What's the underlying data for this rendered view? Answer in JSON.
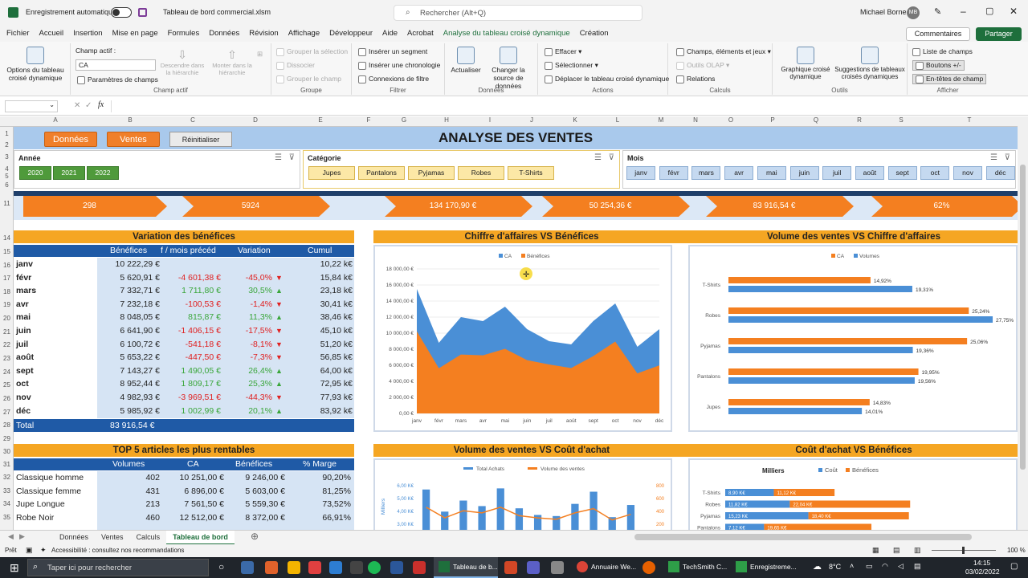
{
  "app": {
    "autosave": "Enregistrement automatique",
    "filename": "Tableau de bord commercial.xlsm",
    "search": "Rechercher (Alt+Q)",
    "user": "Michael Borne",
    "user_initials": "MB"
  },
  "menu": [
    "Fichier",
    "Accueil",
    "Insertion",
    "Mise en page",
    "Formules",
    "Données",
    "Révision",
    "Affichage",
    "Développeur",
    "Aide",
    "Acrobat",
    "Analyse du tableau croisé dynamique",
    "Création"
  ],
  "menu_right": {
    "comments": "Commentaires",
    "share": "Partager"
  },
  "ribbon": {
    "options": "Options du tableau croisé dynamique",
    "champ_actif": "Champ actif :",
    "champ_value": "CA",
    "param": "Paramètres de champs",
    "descendre": "Descendre dans la hiérarchie",
    "monter": "Monter dans la hiérarchie",
    "g_champ": "Champ actif",
    "grp_sel": "Grouper la sélection",
    "dissocier": "Dissocier",
    "grp_champ": "Grouper le champ",
    "g_groupe": "Groupe",
    "segment": "Insérer un segment",
    "chrono": "Insérer une chronologie",
    "connexions": "Connexions de filtre",
    "g_filtre": "Filtrer",
    "actualiser": "Actualiser",
    "changer": "Changer la source de données",
    "g_donnees": "Données",
    "effacer": "Effacer",
    "selectionner": "Sélectionner",
    "deplacer": "Déplacer le tableau croisé dynamique",
    "g_actions": "Actions",
    "champs": "Champs, éléments et jeux",
    "olap": "Outils OLAP",
    "relations": "Relations",
    "g_calculs": "Calculs",
    "graphique": "Graphique croisé dynamique",
    "suggestions": "Suggestions de tableaux croisés dynamiques",
    "g_outils": "Outils",
    "liste": "Liste de champs",
    "boutons": "Boutons +/-",
    "entetes": "En-têtes de champ",
    "g_afficher": "Afficher"
  },
  "columns": [
    "A",
    "B",
    "C",
    "D",
    "E",
    "F",
    "G",
    "H",
    "I",
    "J",
    "K",
    "L",
    "M",
    "N",
    "O",
    "P",
    "Q",
    "R",
    "S",
    "T"
  ],
  "rows": [
    "1",
    "2",
    "3",
    "4",
    "5",
    "6",
    "",
    "11",
    "",
    "14",
    "15",
    "16",
    "17",
    "18",
    "19",
    "20",
    "21",
    "22",
    "23",
    "24",
    "25",
    "26",
    "27",
    "28",
    "29",
    "30",
    "31",
    "32",
    "33",
    "34",
    "35"
  ],
  "dashboard": {
    "btn_donnees": "Données",
    "btn_ventes": "Ventes",
    "btn_reset": "Réinitialiser",
    "title": "ANALYSE DES VENTES",
    "slicer_annee": {
      "title": "Année",
      "items": [
        "2020",
        "2021",
        "2022"
      ]
    },
    "slicer_cat": {
      "title": "Catégorie",
      "items": [
        "Jupes",
        "Pantalons",
        "Pyjamas",
        "Robes",
        "T-Shirts"
      ]
    },
    "slicer_mois": {
      "title": "Mois",
      "items": [
        "janv",
        "févr",
        "mars",
        "avr",
        "mai",
        "juin",
        "juil",
        "août",
        "sept",
        "oct",
        "nov",
        "déc"
      ]
    },
    "kpis": [
      "298",
      "5924",
      "134 170,90 €",
      "50 254,36 €",
      "83 916,54 €",
      "62%"
    ],
    "sec_var": "Variation des bénéfices",
    "sec_ca": "Chiffre d'affaires VS Bénéfices",
    "sec_vol": "Volume des ventes VS Chiffre d'affaires",
    "var_headers": [
      "Bénéfices",
      "f / mois précéd",
      "Variation",
      "Cumul"
    ],
    "var_rows": [
      [
        "janv",
        "10 222,29 €",
        "",
        "",
        "10,22 k€",
        ""
      ],
      [
        "févr",
        "5 620,91 €",
        "-4 601,38 €",
        "-45,0%",
        "15,84 k€",
        "down"
      ],
      [
        "mars",
        "7 332,71 €",
        "1 711,80 €",
        "30,5%",
        "23,18 k€",
        "up"
      ],
      [
        "avr",
        "7 232,18 €",
        "-100,53 €",
        "-1,4%",
        "30,41 k€",
        "down"
      ],
      [
        "mai",
        "8 048,05 €",
        "815,87 €",
        "11,3%",
        "38,46 k€",
        "up"
      ],
      [
        "juin",
        "6 641,90 €",
        "-1 406,15 €",
        "-17,5%",
        "45,10 k€",
        "down"
      ],
      [
        "juil",
        "6 100,72 €",
        "-541,18 €",
        "-8,1%",
        "51,20 k€",
        "down"
      ],
      [
        "août",
        "5 653,22 €",
        "-447,50 €",
        "-7,3%",
        "56,85 k€",
        "down"
      ],
      [
        "sept",
        "7 143,27 €",
        "1 490,05 €",
        "26,4%",
        "64,00 k€",
        "up"
      ],
      [
        "oct",
        "8 952,44 €",
        "1 809,17 €",
        "25,3%",
        "72,95 k€",
        "up"
      ],
      [
        "nov",
        "4 982,93 €",
        "-3 969,51 €",
        "-44,3%",
        "77,93 k€",
        "down"
      ],
      [
        "déc",
        "5 985,92 €",
        "1 002,99 €",
        "20,1%",
        "83,92 k€",
        "up"
      ]
    ],
    "total_label": "Total",
    "total_value": "83 916,54 €",
    "sec_top5": "TOP 5 articles les plus rentables",
    "sec_vol_achat": "Volume des ventes VS Coût d'achat",
    "sec_cout": "Coût d'achat VS Bénéfices",
    "top_headers": [
      "Volumes",
      "CA",
      "Bénéfices",
      "% Marge"
    ],
    "top_rows": [
      [
        "Classique homme",
        "402",
        "10 251,00 €",
        "9 246,00 €",
        "90,20%"
      ],
      [
        "Classique femme",
        "431",
        "6 896,00 €",
        "5 603,00 €",
        "81,25%"
      ],
      [
        "Jupe Longue",
        "213",
        "7 561,50 €",
        "5 559,30 €",
        "73,52%"
      ],
      [
        "Robe Noir",
        "460",
        "12 512,00 €",
        "8 372,00 €",
        "66,91%"
      ]
    ]
  },
  "chart_data": [
    {
      "type": "area",
      "title": "",
      "legend": [
        "CA",
        "Bénéfices"
      ],
      "x": [
        "janv",
        "févr",
        "mars",
        "avr",
        "mai",
        "juin",
        "juil",
        "août",
        "sept",
        "oct",
        "nov",
        "déc"
      ],
      "series": [
        {
          "name": "CA",
          "values": [
            15500,
            8800,
            12000,
            11500,
            13300,
            10500,
            9000,
            8600,
            11500,
            13700,
            8300,
            10500
          ]
        },
        {
          "name": "Bénéfices",
          "values": [
            10222,
            5621,
            7333,
            7232,
            8048,
            6642,
            6101,
            5653,
            7143,
            8952,
            4983,
            5986
          ]
        }
      ],
      "ylim": [
        0,
        18000
      ],
      "yticks": [
        "0,00 €",
        "2 000,00 €",
        "4 000,00 €",
        "6 000,00 €",
        "8 000,00 €",
        "10 000,00 €",
        "12 000,00 €",
        "14 000,00 €",
        "16 000,00 €",
        "18 000,00 €"
      ],
      "colors": [
        "#4a8fd6",
        "#f47f20"
      ]
    },
    {
      "type": "bar",
      "orientation": "horizontal",
      "legend": [
        "CA",
        "Volumes"
      ],
      "categories": [
        "T-Shirts",
        "Robes",
        "Pyjamas",
        "Pantalons",
        "Jupes"
      ],
      "series": [
        {
          "name": "CA",
          "values": [
            14.92,
            25.24,
            25.06,
            19.95,
            14.83
          ],
          "labels": [
            "14,92%",
            "25,24%",
            "25,06%",
            "19,95%",
            "14,83%"
          ]
        },
        {
          "name": "Volumes",
          "values": [
            19.31,
            27.75,
            19.36,
            19.56,
            14.01
          ],
          "labels": [
            "19,31%",
            "27,75%",
            "19,36%",
            "19,56%",
            "14,01%"
          ]
        }
      ],
      "xlim": [
        0,
        28
      ],
      "colors": [
        "#f47f20",
        "#4a8fd6"
      ]
    },
    {
      "type": "bar",
      "legend": [
        "Total Achats",
        "Volume des ventes"
      ],
      "ylabel": "Milliers",
      "yticks_left": [
        "6,00 K€",
        "5,00 K€",
        "4,00 K€",
        "3,00 K€",
        "2,00 K€"
      ],
      "yticks_right": [
        "800",
        "600",
        "400",
        "200"
      ],
      "series": [
        {
          "name": "Total Achats",
          "values": [
            5.8,
            3.8,
            4.8,
            4.3,
            5.9,
            4.1,
            3.5,
            3.4,
            4.5,
            5.6,
            3.3,
            4.4
          ]
        },
        {
          "name": "Volume des ventes",
          "values": [
            520,
            370,
            470,
            440,
            520,
            400,
            370,
            350,
            440,
            500,
            340,
            420
          ]
        }
      ],
      "colors": [
        "#4a8fd6",
        "#f47f20"
      ]
    },
    {
      "type": "bar",
      "orientation": "horizontal",
      "stacked": true,
      "title": "Milliers",
      "legend": [
        "Coût",
        "Bénéfices"
      ],
      "categories": [
        "T-Shirts",
        "Robes",
        "Pyjamas",
        "Pantalons"
      ],
      "series": [
        {
          "name": "Coût",
          "values": [
            8.9,
            11.82,
            15.23,
            7.12
          ],
          "labels": [
            "8,90 K€",
            "11,82 K€",
            "15,23 K€",
            "7,12 K€"
          ]
        },
        {
          "name": "Bénéfices",
          "values": [
            11.12,
            22.04,
            18.4,
            19.65
          ],
          "labels": [
            "11,12 K€",
            "22,04 K€",
            "18,40 K€",
            "19,65 K€"
          ]
        }
      ],
      "colors": [
        "#4a8fd6",
        "#f47f20"
      ]
    }
  ],
  "sheet_tabs": [
    "Données",
    "Ventes",
    "Calculs",
    "Tableau de bord"
  ],
  "status": {
    "ready": "Prêt",
    "access": "Accessibilité : consultez nos recommandations",
    "zoom": "100 %"
  },
  "taskbar": {
    "search": "Taper ici pour rechercher",
    "apps": [
      "Tableau de b...",
      "Annuaire We...",
      "TechSmith C...",
      "Enregistreme..."
    ],
    "temp": "8°C",
    "time": "14:15",
    "date": "03/02/2022"
  }
}
